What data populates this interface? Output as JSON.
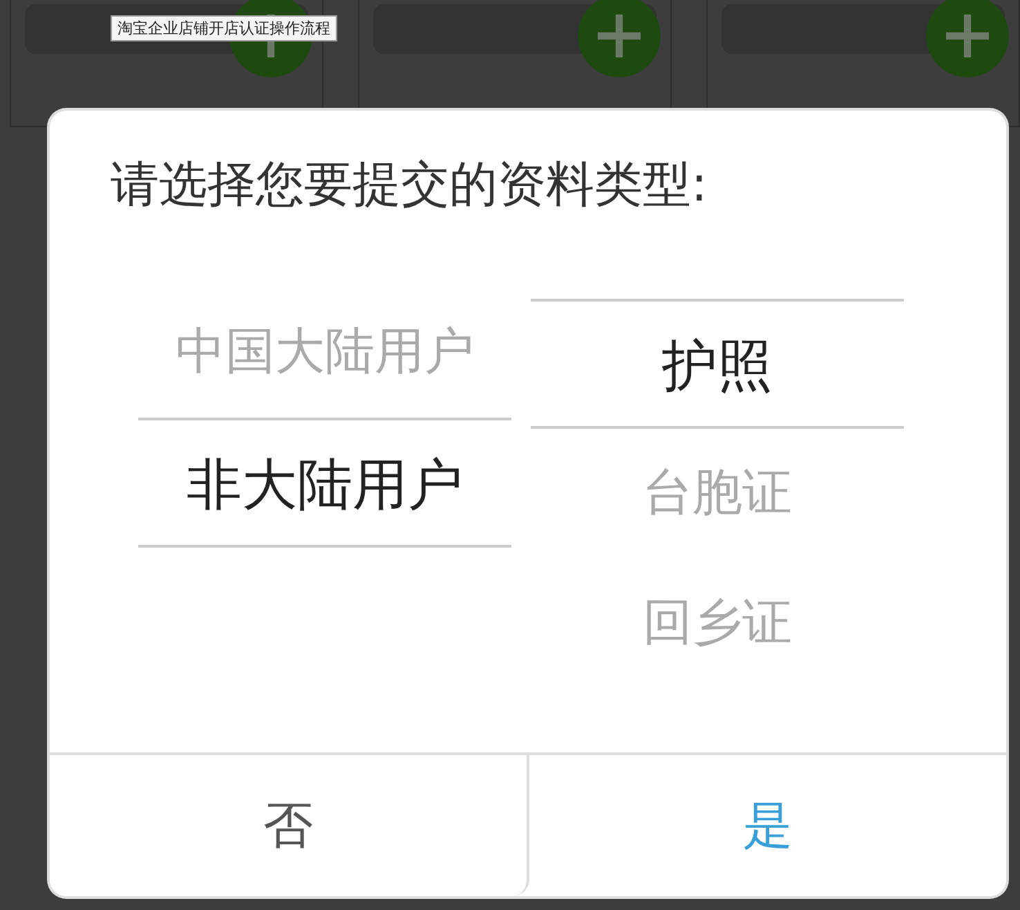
{
  "background": {
    "cards": [
      {
        "kind": "card"
      },
      {
        "kind": "card"
      },
      {
        "kind": "card"
      }
    ],
    "tooltip": "淘宝企业店铺开店认证操作流程"
  },
  "dialog": {
    "title": "请选择您要提交的资料类型:",
    "columns": [
      {
        "items": [
          {
            "label": "中国大陆用户",
            "selected": false
          },
          {
            "label": "非大陆用户",
            "selected": true
          }
        ]
      },
      {
        "items": [
          {
            "label": "护照",
            "selected": true
          },
          {
            "label": "台胞证",
            "selected": false
          },
          {
            "label": "回乡证",
            "selected": false
          }
        ]
      }
    ],
    "buttons": [
      {
        "label": "否",
        "kind": "cancel"
      },
      {
        "label": "是",
        "kind": "confirm"
      }
    ]
  }
}
